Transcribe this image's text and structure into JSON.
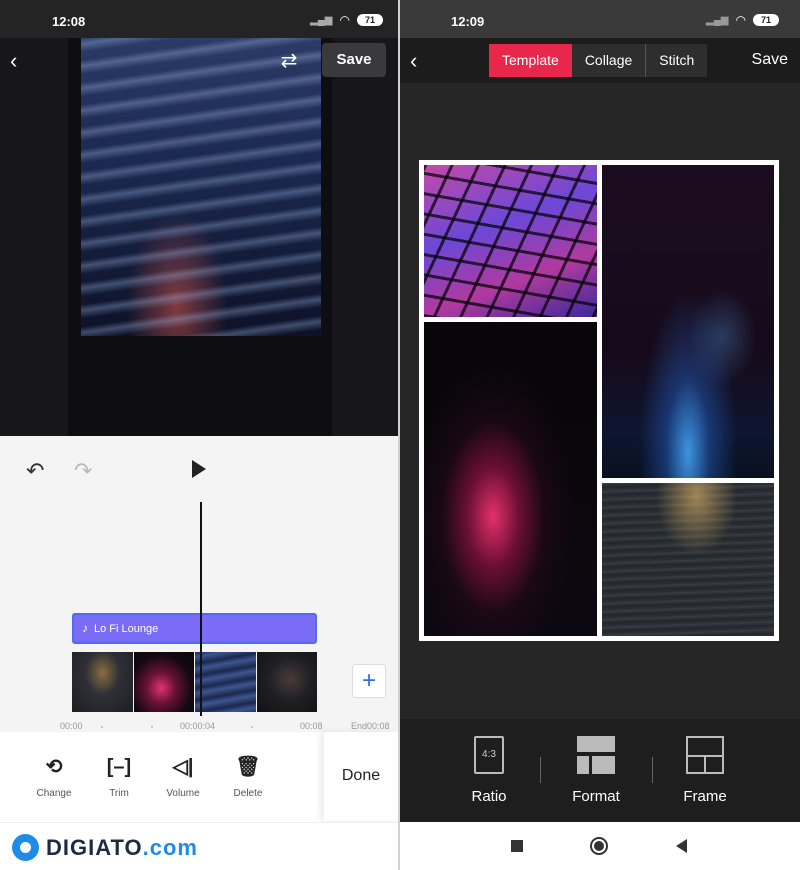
{
  "left": {
    "status_bar": {
      "time": "12:08",
      "battery": "71"
    },
    "header": {
      "save_label": "Save"
    },
    "timeline": {
      "music_track": "Lo Fi Lounge",
      "ruler": {
        "start": "00:00",
        "mid": "00:00:04",
        "late": "00:08",
        "end": "End00:08"
      }
    },
    "tools": {
      "change": "Change",
      "trim": "Trim",
      "volume": "Volume",
      "delete": "Delete",
      "done": "Done"
    }
  },
  "brand": {
    "name": "DIGIATO",
    "suffix": ".com"
  },
  "right": {
    "status_bar": {
      "time": "12:09",
      "battery": "71"
    },
    "header": {
      "tabs": [
        {
          "label": "Template",
          "active": true
        },
        {
          "label": "Collage",
          "active": false
        },
        {
          "label": "Stitch",
          "active": false
        }
      ],
      "save_label": "Save"
    },
    "toolbar": {
      "ratio_label": "Ratio",
      "ratio_icon_text": "4:3",
      "format_label": "Format",
      "frame_label": "Frame"
    }
  },
  "colors": {
    "accent": "#e8274b",
    "music_track": "#7b6cf6",
    "add_button": "#2a6df0",
    "brand": "#1f8be6"
  }
}
